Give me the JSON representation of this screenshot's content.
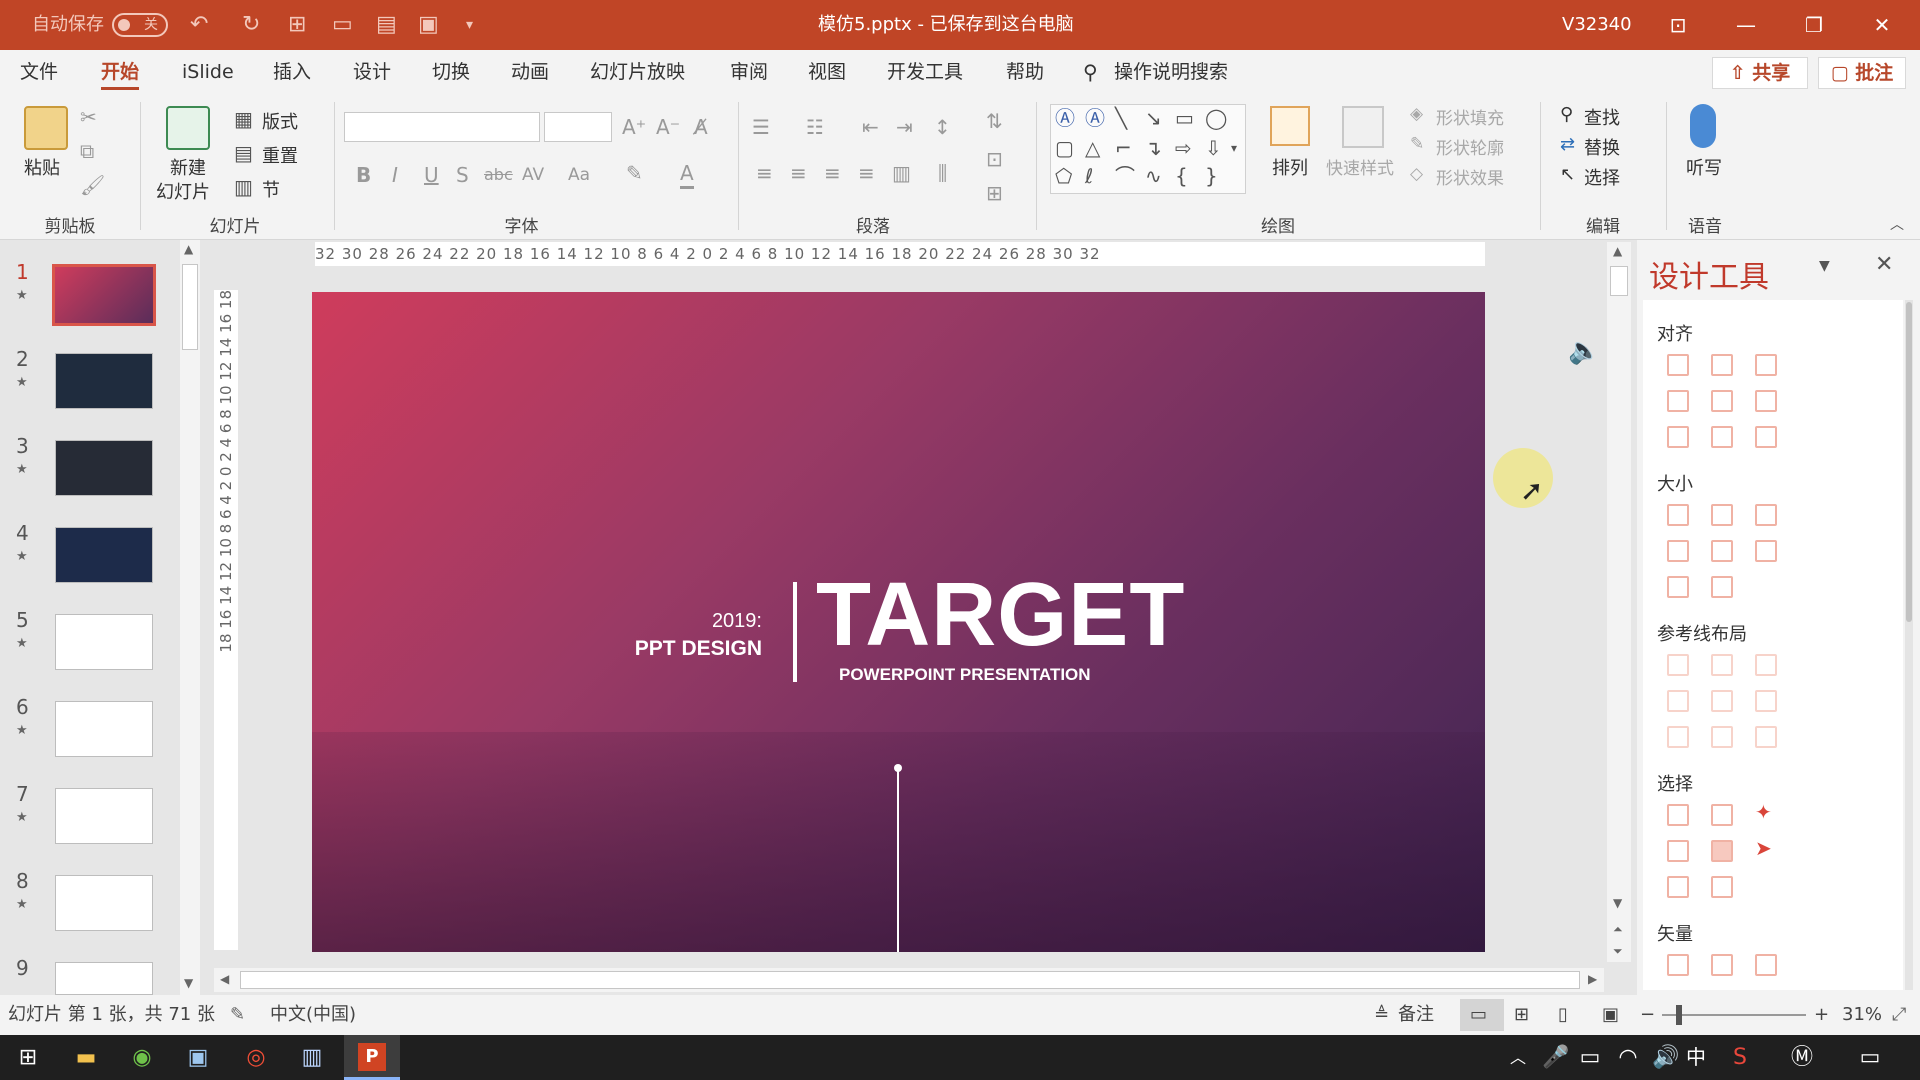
{
  "titlebar": {
    "autosave_label": "自动保存",
    "autosave_toggle": "关",
    "doc_title": "模仿5.pptx - 已保存到这台电脑",
    "user": "V32340"
  },
  "menu": {
    "tabs": [
      "文件",
      "开始",
      "iSlide",
      "插入",
      "设计",
      "切换",
      "动画",
      "幻灯片放映",
      "审阅",
      "视图",
      "开发工具",
      "帮助"
    ],
    "search_label": "操作说明搜索",
    "share_label": "共享",
    "comment_label": "批注"
  },
  "ribbon": {
    "clipboard": {
      "paste": "粘贴",
      "group": "剪贴板"
    },
    "slides": {
      "new_slide_1": "新建",
      "new_slide_2": "幻灯片",
      "layout": "版式",
      "reset": "重置",
      "section": "节",
      "group": "幻灯片"
    },
    "font": {
      "bold": "B",
      "italic": "I",
      "underline": "U",
      "shadow": "S",
      "strike": "abc",
      "spacing": "AV",
      "case": "Aa",
      "color": "A",
      "group": "字体"
    },
    "paragraph": {
      "group": "段落"
    },
    "drawing": {
      "arrange": "排列",
      "quick_styles": "快速样式",
      "fill": "形状填充",
      "outline": "形状轮廓",
      "effects": "形状效果",
      "group": "绘图"
    },
    "editing": {
      "find": "查找",
      "replace": "替换",
      "select": "选择",
      "group": "编辑"
    },
    "voice": {
      "dictate": "听写",
      "group": "语音"
    }
  },
  "ruler": {
    "horizontal": "32 30 28 26 24 22 20 18 16 14 12 10 8 6 4 2 0 2 4 6 8 10 12 14 16 18 20 22 24 26 28 30 32",
    "vertical": "18 16 14 12 10 8 6 4 2 0 2 4 6 8 10 12 14 16 18"
  },
  "thumbnails": [
    {
      "num": "1",
      "bg": "#b83a62"
    },
    {
      "num": "2",
      "bg": "#1f2c3e"
    },
    {
      "num": "3",
      "bg": "#262b36"
    },
    {
      "num": "4",
      "bg": "#1d2b4a"
    },
    {
      "num": "5",
      "bg": "#ffffff"
    },
    {
      "num": "6",
      "bg": "#ffffff"
    },
    {
      "num": "7",
      "bg": "#ffffff"
    },
    {
      "num": "8",
      "bg": "#ffffff"
    },
    {
      "num": "9",
      "bg": "#ffffff"
    }
  ],
  "slide": {
    "year": "2019:",
    "subtitle_left": "PPT DESIGN",
    "title": "TARGET",
    "subtitle": "POWERPOINT PRESENTATION"
  },
  "design_panel": {
    "title": "设计工具",
    "sections": [
      "对齐",
      "大小",
      "参考线布局",
      "选择",
      "矢量"
    ]
  },
  "status": {
    "slide_info": "幻灯片 第 1 张，共 71 张",
    "language": "中文(中国)",
    "notes": "备注",
    "zoom": "31%"
  },
  "taskbar": {
    "ime": "中"
  },
  "colors": {
    "accent": "#b7472a",
    "titlebar": "#c04526"
  }
}
